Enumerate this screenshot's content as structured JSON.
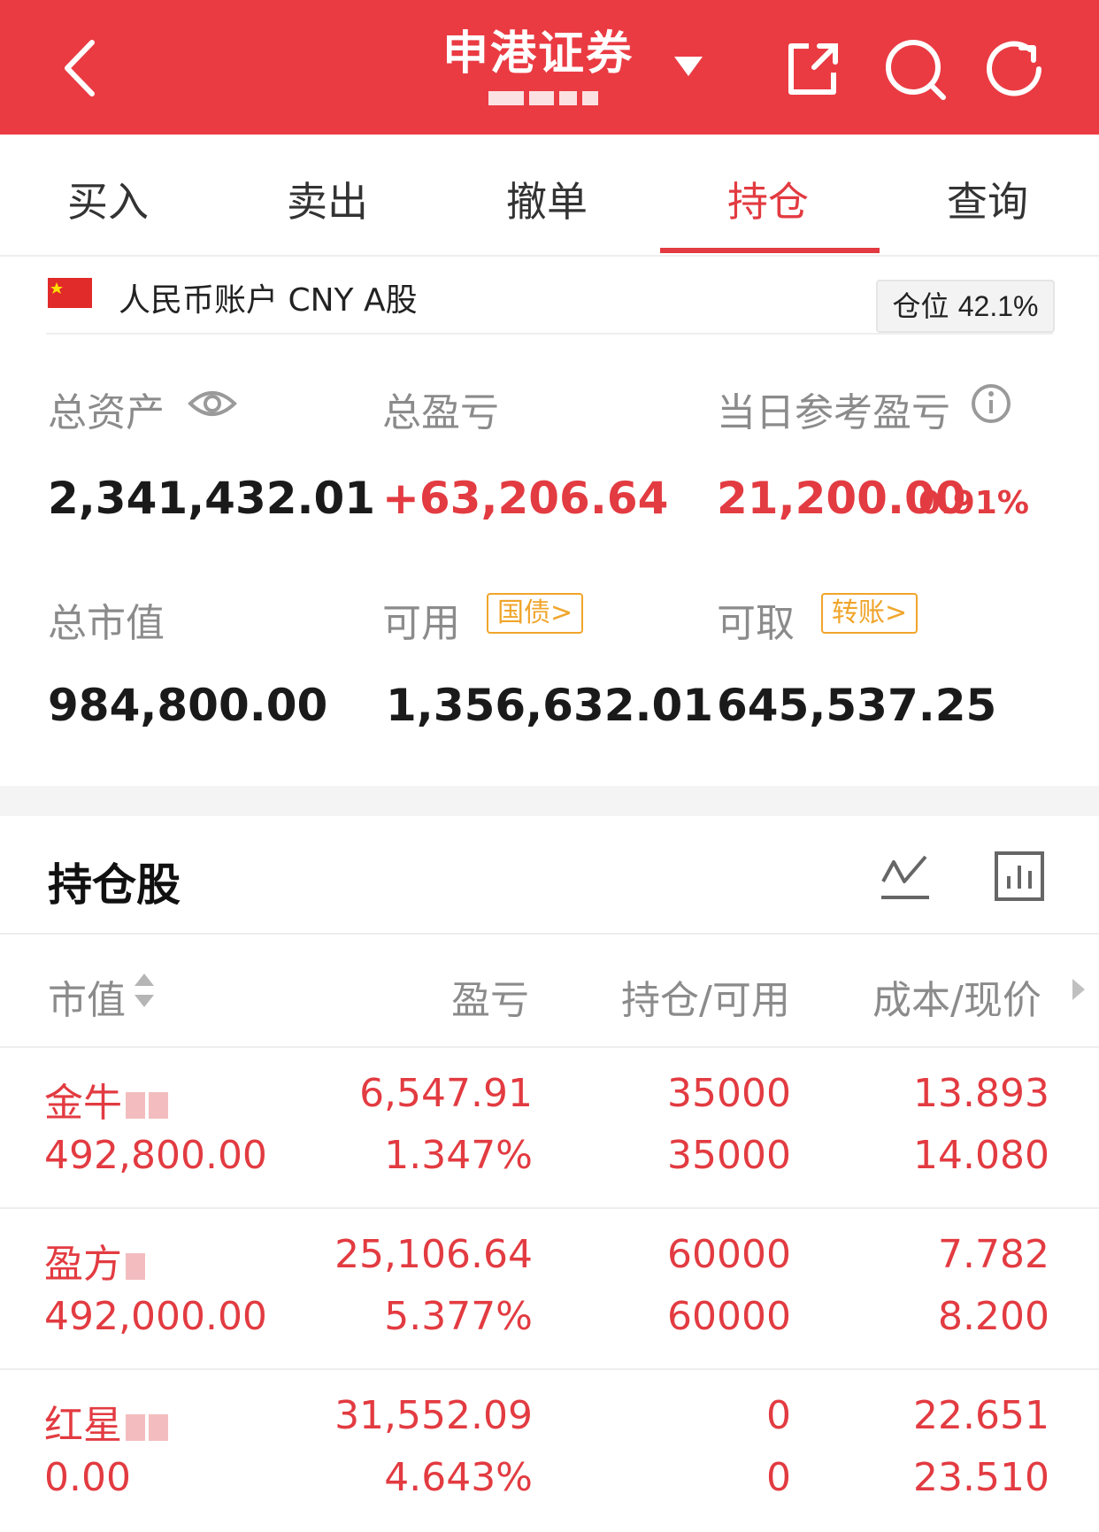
{
  "header": {
    "title": "申港证券",
    "subtitle_mask": "███ █",
    "icons": [
      "back-icon",
      "chevron-down-icon",
      "share-icon",
      "search-icon",
      "refresh-icon"
    ]
  },
  "tabs": [
    {
      "label": "买入"
    },
    {
      "label": "卖出"
    },
    {
      "label": "撤单"
    },
    {
      "label": "持仓"
    },
    {
      "label": "查询"
    }
  ],
  "active_tab": "持仓",
  "account": {
    "label": "人民币账户 CNY A股",
    "position_label": "仓位",
    "position_value": "42.1%"
  },
  "summary": {
    "total_assets_label": "总资产",
    "total_assets": "2,341,432.01",
    "total_pl_label": "总盈亏",
    "total_pl": "+63,206.64",
    "day_pl_label": "当日参考盈亏",
    "day_pl": "21,200.00",
    "day_pl_pct": "0.91%",
    "market_value_label": "总市值",
    "market_value": "984,800.00",
    "available_label": "可用",
    "available_tag": "国债>",
    "available": "1,356,632.01",
    "withdrawable_label": "可取",
    "withdrawable_tag": "转账>",
    "withdrawable": "645,537.25"
  },
  "holdings": {
    "title": "持仓股",
    "columns": {
      "c1": "市值",
      "c2": "盈亏",
      "c3": "持仓/可用",
      "c4": "成本/现价"
    },
    "rows": [
      {
        "name": "金牛",
        "market_value": "492,800.00",
        "pl": "6,547.91",
        "pl_pct": "1.347%",
        "position": "35000",
        "available": "35000",
        "cost": "13.893",
        "price": "14.080"
      },
      {
        "name": "盈方",
        "market_value": "492,000.00",
        "pl": "25,106.64",
        "pl_pct": "5.377%",
        "position": "60000",
        "available": "60000",
        "cost": "7.782",
        "price": "8.200"
      },
      {
        "name": "红星",
        "market_value": "0.00",
        "pl": "31,552.09",
        "pl_pct": "4.643%",
        "position": "0",
        "available": "0",
        "cost": "22.651",
        "price": "23.510"
      }
    ]
  },
  "colors": {
    "brand_red": "#ea3b43",
    "accent_red": "#e23b41",
    "tag_orange": "#f0a52b"
  }
}
